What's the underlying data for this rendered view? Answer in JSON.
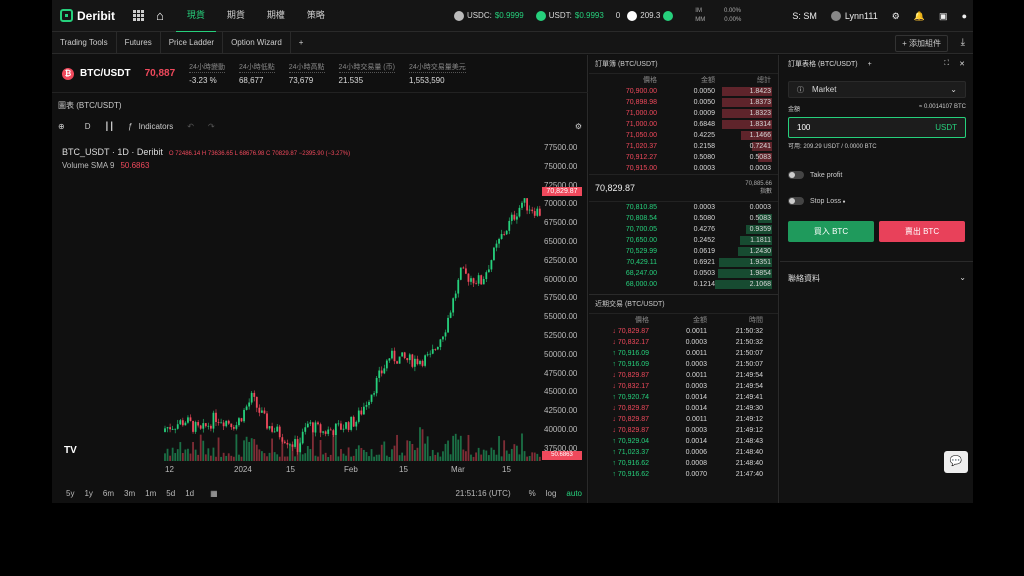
{
  "brand": "Deribit",
  "nav": [
    "現貨",
    "期貨",
    "期權",
    "策略"
  ],
  "tickers": [
    {
      "sym": "USDC:",
      "val": "$0.9999"
    },
    {
      "sym": "USDT:",
      "val": "$0.9993"
    }
  ],
  "balance": {
    "count": "0",
    "value": "209.3"
  },
  "im": {
    "label": "IM",
    "value": "0.00%"
  },
  "mm": {
    "label": "MM",
    "value": "0.00%"
  },
  "sm": "S: SM",
  "user": "Lynn111",
  "subtabs": [
    "Trading Tools",
    "Futures",
    "Price Ladder",
    "Option Wizard",
    "+"
  ],
  "add_widget": "+ 添加組件",
  "symbol": "BTC/USDT",
  "last_price": "70,887",
  "stats": [
    {
      "label": "24小時變動",
      "value": "-3.23 %"
    },
    {
      "label": "24小時低點",
      "value": "68,677"
    },
    {
      "label": "24小時高點",
      "value": "73,679"
    },
    {
      "label": "24小時交易量 (币)",
      "value": "21.535"
    },
    {
      "label": "24小時交易量美元",
      "value": "1,553,590"
    }
  ],
  "chart_title": "圖表 (BTC/USDT)",
  "interval": "D",
  "indicators": "Indicators",
  "legend_line1": "BTC_USDT · 1D · Deribit",
  "ohlc": "O 72486.14  H 73636.65  L 68676.98  C 70829.87  −2395.90 (−3.27%)",
  "legend_line2": "Volume SMA 9",
  "vol_value": "50.6863",
  "yticks": [
    "77500.00",
    "75000.00",
    "72500.00",
    "70000.00",
    "67500.00",
    "65000.00",
    "62500.00",
    "60000.00",
    "57500.00",
    "55000.00",
    "52500.00",
    "50000.00",
    "47500.00",
    "45000.00",
    "42500.00",
    "40000.00",
    "37500.00"
  ],
  "price_tag": "70,829.87",
  "xticks": [
    "12",
    "2024",
    "15",
    "Feb",
    "15",
    "Mar",
    "15"
  ],
  "ranges": [
    "5y",
    "1y",
    "6m",
    "3m",
    "1m",
    "5d",
    "1d"
  ],
  "time_info": "21:51:16 (UTC)",
  "scale_opts": [
    "%",
    "log",
    "auto"
  ],
  "ob_title": "訂單簿 (BTC/USDT)",
  "ob_headers": [
    "價格",
    "金額",
    "總計"
  ],
  "asks": [
    [
      "70,900.00",
      "0.0050",
      "1.8423"
    ],
    [
      "70,898.98",
      "0.0050",
      "1.8373"
    ],
    [
      "71,000.00",
      "0.0009",
      "1.8323"
    ],
    [
      "71,000.00",
      "0.6848",
      "1.8314"
    ],
    [
      "71,050.00",
      "0.4225",
      "1.1466"
    ],
    [
      "71,020.37",
      "0.2158",
      "0.7241"
    ],
    [
      "70,912.27",
      "0.5080",
      "0.5083"
    ],
    [
      "70,915.00",
      "0.0003",
      "0.0003"
    ]
  ],
  "mid_price": "70,829.87",
  "mid_index": "70,885.66",
  "mid_index_label": "指數",
  "bids": [
    [
      "70,810.85",
      "0.0003",
      "0.0003"
    ],
    [
      "70,808.54",
      "0.5080",
      "0.5083"
    ],
    [
      "70,700.05",
      "0.4276",
      "0.9359"
    ],
    [
      "70,650.00",
      "0.2452",
      "1.1811"
    ],
    [
      "70,529.99",
      "0.0619",
      "1.2430"
    ],
    [
      "70,429.11",
      "0.6921",
      "1.9351"
    ],
    [
      "68,247.00",
      "0.0503",
      "1.9854"
    ],
    [
      "68,000.00",
      "0.1214",
      "2.1068"
    ]
  ],
  "trades_title": "近期交易 (BTC/USDT)",
  "trade_headers": [
    "價格",
    "金額",
    "時間"
  ],
  "trades": [
    [
      "70,829.87",
      "0.0011",
      "21:50:32",
      "down"
    ],
    [
      "70,832.17",
      "0.0003",
      "21:50:32",
      "down"
    ],
    [
      "70,916.09",
      "0.0011",
      "21:50:07",
      "up"
    ],
    [
      "70,916.09",
      "0.0003",
      "21:50:07",
      "up"
    ],
    [
      "70,829.87",
      "0.0011",
      "21:49:54",
      "down"
    ],
    [
      "70,832.17",
      "0.0003",
      "21:49:54",
      "down"
    ],
    [
      "70,920.74",
      "0.0014",
      "21:49:41",
      "up"
    ],
    [
      "70,829.87",
      "0.0014",
      "21:49:30",
      "down"
    ],
    [
      "70,829.87",
      "0.0011",
      "21:49:12",
      "down"
    ],
    [
      "70,829.87",
      "0.0003",
      "21:49:12",
      "down"
    ],
    [
      "70,929.04",
      "0.0014",
      "21:48:43",
      "up"
    ],
    [
      "71,023.37",
      "0.0006",
      "21:48:40",
      "up"
    ],
    [
      "70,916.62",
      "0.0008",
      "21:48:40",
      "up"
    ],
    [
      "70,916.62",
      "0.0070",
      "21:47:40",
      "up"
    ]
  ],
  "order_title": "訂單表格 (BTC/USDT)",
  "order_type": "Market",
  "amount_label": "金額",
  "amount_est": "≈ 0.0014107 BTC",
  "amount_value": "100",
  "amount_unit": "USDT",
  "available": "可用: 209.29 USDT / 0.0000 BTC",
  "take_profit": "Take profit",
  "stop_loss": "Stop Loss",
  "buy": "買入 BTC",
  "sell": "賣出 BTC",
  "linked": "聯絡資料",
  "colors": {
    "green": "#26d07c",
    "red": "#f0495c"
  }
}
